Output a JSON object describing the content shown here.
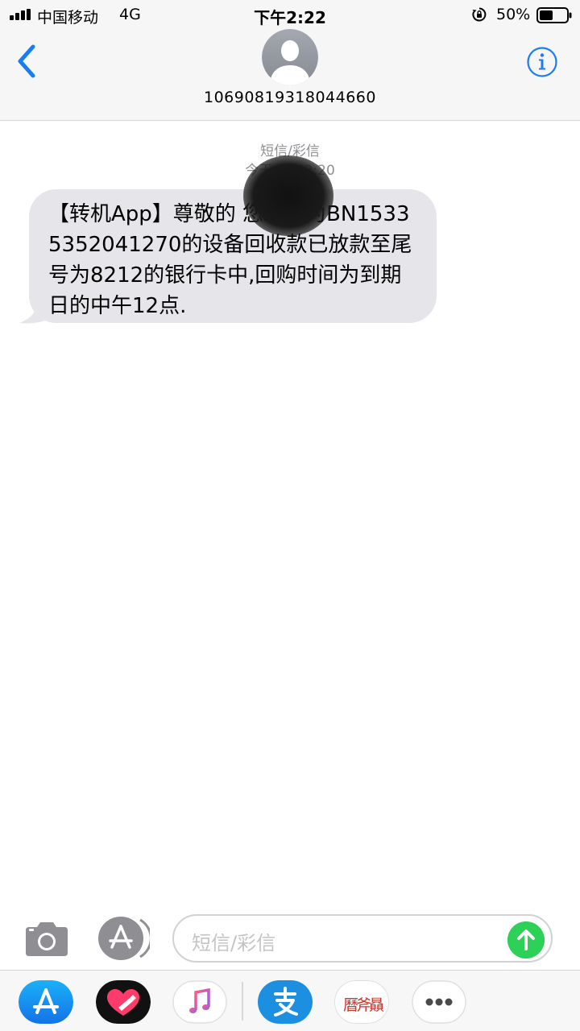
{
  "status_bar": {
    "carrier": "中国移动",
    "network": "4G",
    "time": "下午2:22",
    "battery_percent": "50%",
    "battery_level": 0.5
  },
  "header": {
    "contact": "10690819318044660",
    "icons": {
      "back": "chevron-left-icon",
      "avatar": "person-silhouette-icon",
      "info": "info-icon"
    }
  },
  "thread": {
    "message_type": "短信/彩信",
    "timestamp": "今天 下午2:20",
    "messages": [
      {
        "direction": "incoming",
        "text": "【转机App】尊敬的        您编号为BN15335352041270的设备回收款已放款至尾号为8212的银行卡中,回购时间为到期日的中午12点."
      }
    ]
  },
  "input_bar": {
    "placeholder": "短信/彩信",
    "icons": {
      "camera": "camera-icon",
      "apps": "app-store-icon",
      "send": "send-arrow-icon"
    }
  },
  "drawer": {
    "apps": [
      {
        "name": "app-store",
        "icon": "app-store-icon"
      },
      {
        "name": "digital-touch",
        "icon": "heart-touch-icon"
      },
      {
        "name": "music",
        "icon": "music-note-icon"
      },
      {
        "name": "alipay",
        "icon": "alipay-icon",
        "glyph": "支"
      },
      {
        "name": "seal",
        "icon": "red-seal-icon",
        "glyph": "曆斧贔"
      },
      {
        "name": "more",
        "icon": "more-dots-icon"
      }
    ]
  },
  "colors": {
    "accent": "#1a7cf2",
    "bubble_incoming": "#e5e5ea",
    "send": "#2ed158",
    "alipay": "#1d8fe0",
    "seal": "#c8352c",
    "meta_text": "#8e8e93"
  }
}
